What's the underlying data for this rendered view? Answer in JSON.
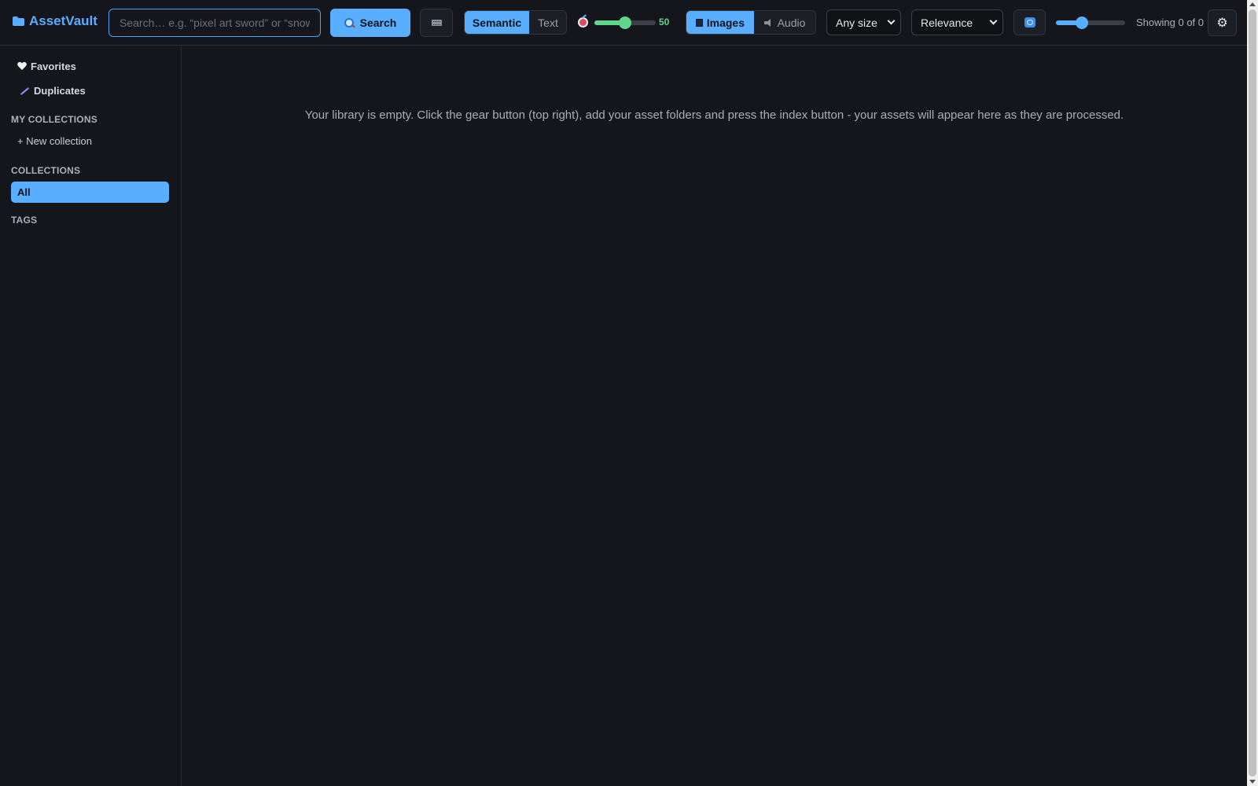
{
  "app": {
    "title": "AssetVault"
  },
  "search": {
    "value": "",
    "placeholder": "Search… e.g. “pixel art sword” or “snow footsteps”",
    "button_label": "Search"
  },
  "mode_toggle": {
    "options": [
      "Semantic",
      "Text"
    ],
    "selected": "Semantic"
  },
  "similarity": {
    "value": 50,
    "min": 0,
    "max": 100,
    "label": "50"
  },
  "type_toggle": {
    "options": [
      "Images",
      "Audio"
    ],
    "selected": "Images"
  },
  "size_filter": {
    "selected": "Any size"
  },
  "sort": {
    "selected": "Relevance"
  },
  "zoom": {
    "value": 0.38
  },
  "status": {
    "showing": "Showing 0 of 0"
  },
  "sidebar": {
    "favorites": "Favorites",
    "duplicates": "Duplicates",
    "my_collections_title": "MY COLLECTIONS",
    "new_collection": "+ New collection",
    "collections_title": "COLLECTIONS",
    "collections": [
      "All"
    ],
    "tags_title": "TAGS"
  },
  "main": {
    "empty_message": "Your library is empty. Click the gear button (top right), add your asset folders and press the index button - your assets will appear here as they are processed."
  },
  "icons": {
    "brand": "folder-icon",
    "search": "magnifier-icon",
    "keyboard": "keyboard-icon",
    "similarity": "target-icon",
    "images": "image-icon",
    "audio": "speaker-icon",
    "refresh": "refresh-icon",
    "settings": "gear-icon",
    "favorites": "heart-icon",
    "duplicates": "dna-icon"
  },
  "colors": {
    "accent": "#5aaeff",
    "similarity": "#5fd68a",
    "background": "#14161b"
  }
}
